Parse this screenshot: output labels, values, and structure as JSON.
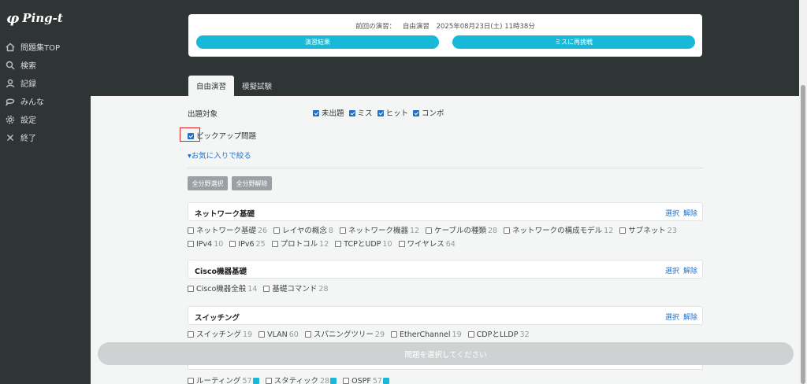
{
  "sidebar": {
    "logo_mark": "φ",
    "logo_text": "Ping-t",
    "items": [
      {
        "label": "問題集TOP",
        "icon": "home-icon"
      },
      {
        "label": "検索",
        "icon": "search-icon"
      },
      {
        "label": "記録",
        "icon": "user-icon"
      },
      {
        "label": "みんな",
        "icon": "chat-icon"
      },
      {
        "label": "設定",
        "icon": "gear-icon"
      },
      {
        "label": "終了",
        "icon": "close-icon"
      }
    ]
  },
  "last_session": {
    "label": "前回の演習：",
    "mode": "自由演習",
    "datetime": "2025年08月23日(土) 11時38分",
    "result_button": "演習結果",
    "retry_button": "ミスに再挑戦"
  },
  "tabs": [
    {
      "label": "自由演習",
      "active": true
    },
    {
      "label": "模擬試験",
      "active": false
    }
  ],
  "filters": {
    "target_label": "出題対象",
    "targets": [
      {
        "label": "未出題",
        "checked": true
      },
      {
        "label": "ミス",
        "checked": true
      },
      {
        "label": "ヒット",
        "checked": true
      },
      {
        "label": "コンボ",
        "checked": true
      }
    ],
    "pickup_label": "ピックアップ問題",
    "pickup_checked": true,
    "favorite_toggle": "お気に入りで絞る",
    "select_all_button": "全分野選択",
    "clear_all_button": "全分野解除"
  },
  "categories": [
    {
      "title": "ネットワーク基礎",
      "select_label": "選択",
      "clear_label": "解除",
      "rows": [
        [
          {
            "name": "ネットワーク基礎",
            "count": "26"
          },
          {
            "name": "レイヤの概念",
            "count": "8"
          },
          {
            "name": "ネットワーク機器",
            "count": "12"
          },
          {
            "name": "ケーブルの種類",
            "count": "28"
          },
          {
            "name": "ネットワークの構成モデル",
            "count": "12"
          },
          {
            "name": "サブネット",
            "count": "23"
          }
        ],
        [
          {
            "name": "IPv4",
            "count": "10"
          },
          {
            "name": "IPv6",
            "count": "25"
          },
          {
            "name": "プロトコル",
            "count": "12"
          },
          {
            "name": "TCPとUDP",
            "count": "10"
          },
          {
            "name": "ワイヤレス",
            "count": "64"
          }
        ]
      ]
    },
    {
      "title": "Cisco機器基礎",
      "select_label": "選択",
      "clear_label": "解除",
      "rows": [
        [
          {
            "name": "Cisco機器全般",
            "count": "14"
          },
          {
            "name": "基礎コマンド",
            "count": "28"
          }
        ]
      ]
    },
    {
      "title": "スイッチング",
      "select_label": "選択",
      "clear_label": "解除",
      "rows": [
        [
          {
            "name": "スイッチング",
            "count": "19"
          },
          {
            "name": "VLAN",
            "count": "60"
          },
          {
            "name": "スパニングツリー",
            "count": "29"
          },
          {
            "name": "EtherChannel",
            "count": "19"
          },
          {
            "name": "CDPとLLDP",
            "count": "32"
          }
        ]
      ]
    }
  ],
  "partial_row": [
    {
      "name": "ルーティング",
      "count": "57"
    },
    {
      "name": "スタティック",
      "count": "28"
    },
    {
      "name": "OSPF",
      "count": "57"
    }
  ],
  "bottom_button": "問題を選択してください",
  "colors": {
    "accent": "#18b9d8",
    "link": "#1f72c9",
    "sidebar": "#2f3435"
  }
}
